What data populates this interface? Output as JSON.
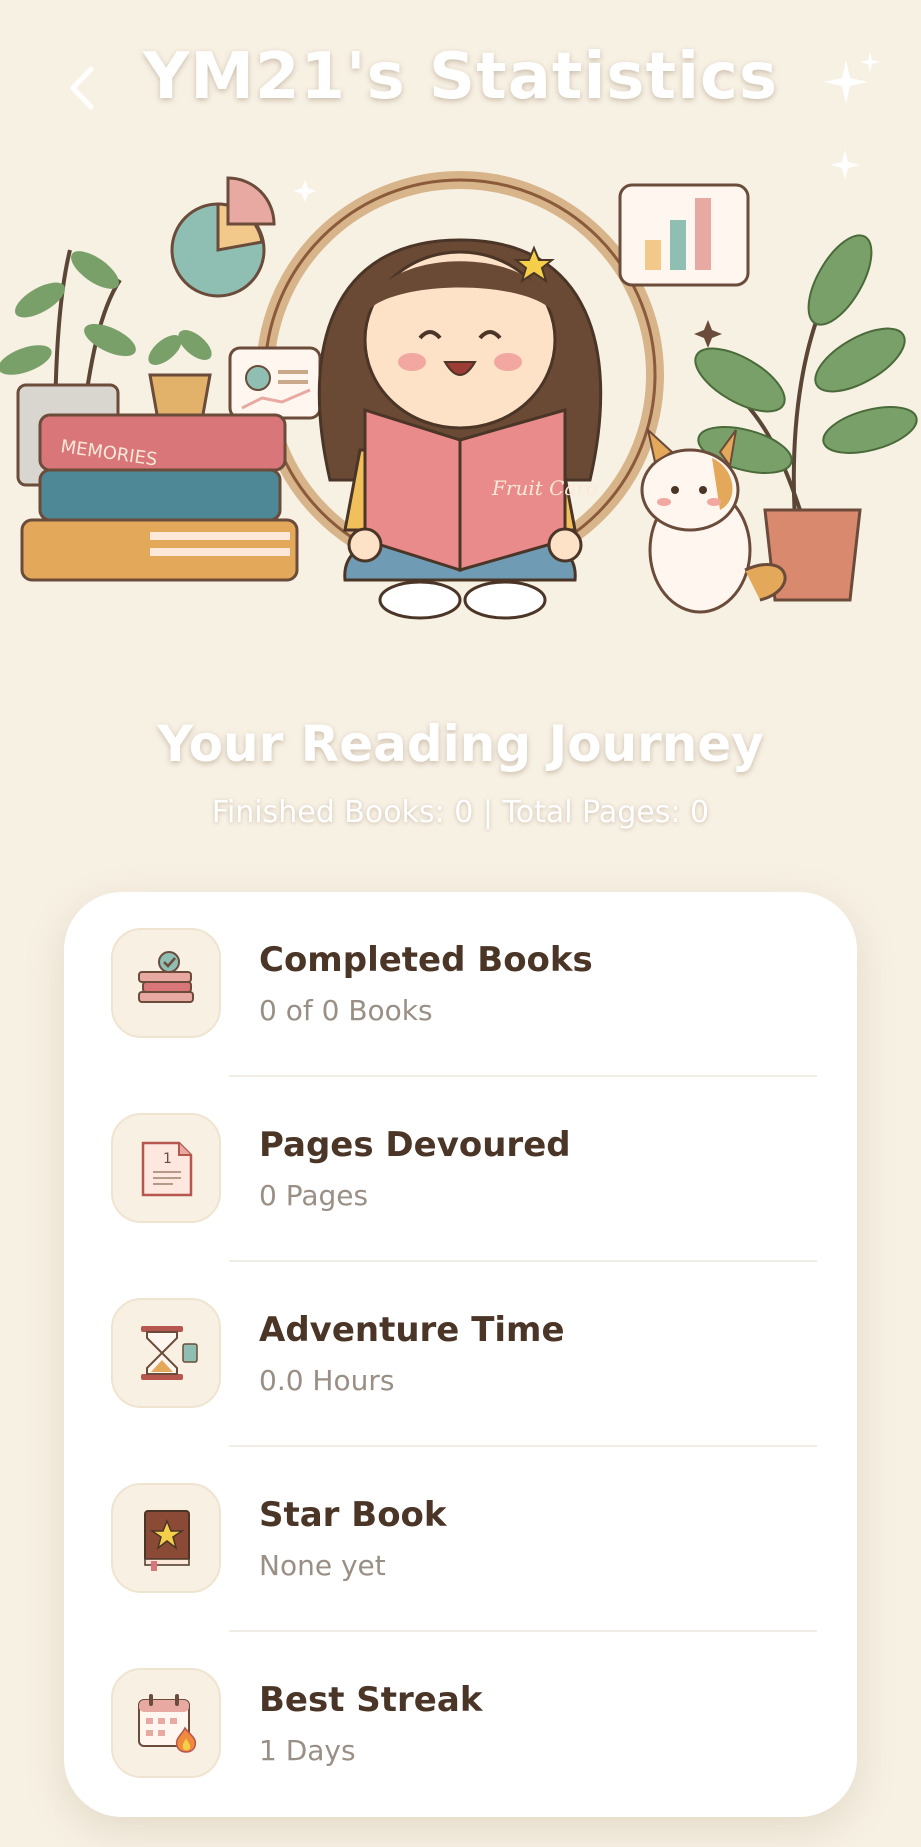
{
  "header": {
    "title": "YM21's Statistics",
    "back_icon": "chevron-left-icon"
  },
  "hero": {
    "illustration": "girl-reading-book-illustration",
    "book_stack_label": "MEMORIES",
    "open_book_text": "Fruit Caro"
  },
  "summary": {
    "title": "Your Reading Journey",
    "subtitle": "Finished Books: 0 | Total Pages: 0"
  },
  "stats": [
    {
      "title": "Completed Books",
      "value": "0 of 0 Books",
      "icon": "book-stack-check-icon"
    },
    {
      "title": "Pages Devoured",
      "value": "0 Pages",
      "icon": "page-icon"
    },
    {
      "title": "Adventure Time",
      "value": "0.0 Hours",
      "icon": "hourglass-icon"
    },
    {
      "title": "Star Book",
      "value": "None yet",
      "icon": "star-book-icon"
    },
    {
      "title": "Best Streak",
      "value": "1 Days",
      "icon": "calendar-flame-icon"
    }
  ],
  "colors": {
    "background": "#f7f1e4",
    "card": "#ffffff",
    "title_text": "#4a3526",
    "value_text": "#9a8f85"
  }
}
